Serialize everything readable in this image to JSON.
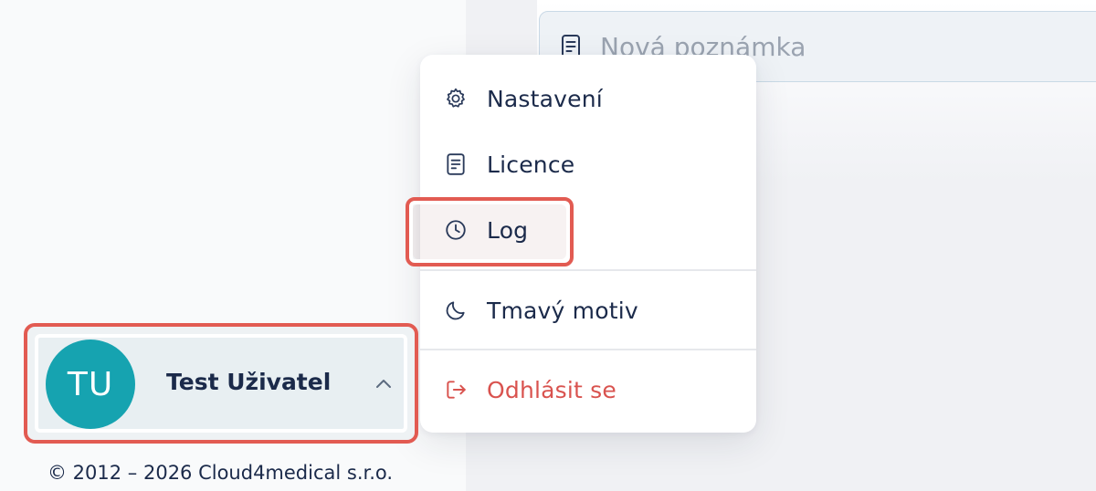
{
  "note": {
    "placeholder": "Nová poznámka",
    "icon": "note-icon"
  },
  "menu": {
    "items": [
      {
        "label": "Nastavení",
        "icon": "gear-icon"
      },
      {
        "label": "Licence",
        "icon": "document-icon"
      },
      {
        "label": "Log",
        "icon": "clock-icon"
      },
      {
        "label": "Tmavý motiv",
        "icon": "moon-icon"
      },
      {
        "label": "Odhlásit se",
        "icon": "logout-icon"
      }
    ]
  },
  "user": {
    "initials": "TU",
    "name": "Test Uživatel",
    "chevron": "chevron-up-icon"
  },
  "footer": {
    "copyright": "© 2012 – 2026 Cloud4medical s.r.o."
  },
  "colors": {
    "accent": "#16a3b0",
    "danger": "#d9534f",
    "highlight": "#e25b52",
    "text": "#1b2a4a"
  }
}
